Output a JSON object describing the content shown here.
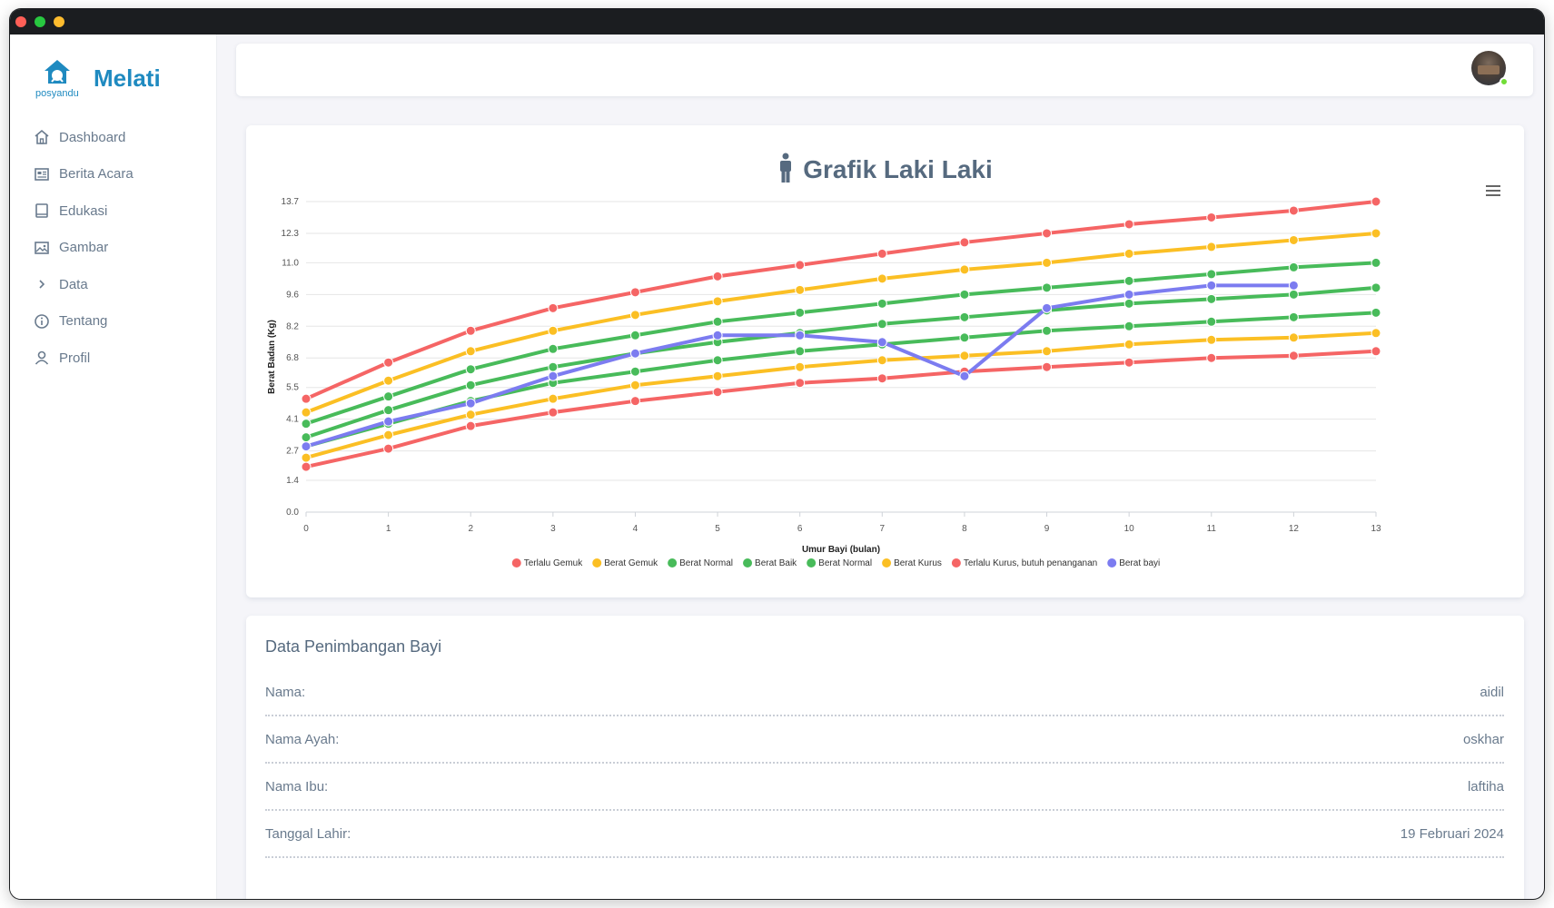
{
  "app": {
    "brand_name": "Melati",
    "logo_caption": "posyandu"
  },
  "sidebar": {
    "items": [
      {
        "label": "Dashboard",
        "icon": "home-icon"
      },
      {
        "label": "Berita Acara",
        "icon": "news-icon"
      },
      {
        "label": "Edukasi",
        "icon": "book-icon"
      },
      {
        "label": "Gambar",
        "icon": "image-icon"
      },
      {
        "label": "Data",
        "icon": "chevron-right-icon"
      },
      {
        "label": "Tentang",
        "icon": "info-icon"
      },
      {
        "label": "Profil",
        "icon": "user-icon"
      }
    ]
  },
  "topbar": {
    "avatar": "user-avatar",
    "status_color": "#71dd37"
  },
  "chart_card": {
    "title": "Grafik Laki Laki",
    "menu_icon": "hamburger-menu-icon"
  },
  "chart_data": {
    "type": "line",
    "title": "Grafik Laki Laki",
    "xlabel": "Umur Bayi (bulan)",
    "ylabel": "Berat Badan (Kg)",
    "x": [
      0,
      1,
      2,
      3,
      4,
      5,
      6,
      7,
      8,
      9,
      10,
      11,
      12,
      13
    ],
    "yticks": [
      "0.0",
      "1.4",
      "2.7",
      "4.1",
      "5.5",
      "6.8",
      "8.2",
      "9.6",
      "11.0",
      "12.3",
      "13.7"
    ],
    "ylim": [
      0,
      13.7
    ],
    "grid": true,
    "legend": "bottom",
    "series": [
      {
        "name": "Terlalu Gemuk",
        "color": "#f56565",
        "values": [
          5.0,
          6.6,
          8.0,
          9.0,
          9.7,
          10.4,
          10.9,
          11.4,
          11.9,
          12.3,
          12.7,
          13.0,
          13.3,
          13.7
        ]
      },
      {
        "name": "Berat Gemuk",
        "color": "#fbbf24",
        "values": [
          4.4,
          5.8,
          7.1,
          8.0,
          8.7,
          9.3,
          9.8,
          10.3,
          10.7,
          11.0,
          11.4,
          11.7,
          12.0,
          12.3
        ]
      },
      {
        "name": "Berat Normal",
        "color": "#48bb5a",
        "values": [
          3.9,
          5.1,
          6.3,
          7.2,
          7.8,
          8.4,
          8.8,
          9.2,
          9.6,
          9.9,
          10.2,
          10.5,
          10.8,
          11.0
        ]
      },
      {
        "name": "Berat Baik",
        "color": "#48bb5a",
        "values": [
          3.3,
          4.5,
          5.6,
          6.4,
          7.0,
          7.5,
          7.9,
          8.3,
          8.6,
          8.9,
          9.2,
          9.4,
          9.6,
          9.9
        ]
      },
      {
        "name": "Berat Normal",
        "color": "#48bb5a",
        "values": [
          2.9,
          3.9,
          4.9,
          5.7,
          6.2,
          6.7,
          7.1,
          7.4,
          7.7,
          8.0,
          8.2,
          8.4,
          8.6,
          8.8
        ]
      },
      {
        "name": "Berat Kurus",
        "color": "#fbbf24",
        "values": [
          2.4,
          3.4,
          4.3,
          5.0,
          5.6,
          6.0,
          6.4,
          6.7,
          6.9,
          7.1,
          7.4,
          7.6,
          7.7,
          7.9
        ]
      },
      {
        "name": "Terlalu Kurus, butuh penanganan",
        "color": "#f56565",
        "values": [
          2.0,
          2.8,
          3.8,
          4.4,
          4.9,
          5.3,
          5.7,
          5.9,
          6.2,
          6.4,
          6.6,
          6.8,
          6.9,
          7.1
        ]
      },
      {
        "name": "Berat bayi",
        "color": "#7c7cf0",
        "values": [
          2.9,
          4.0,
          4.8,
          6.0,
          7.0,
          7.8,
          7.8,
          7.5,
          6.0,
          9.0,
          9.6,
          10.0,
          10.0,
          null
        ]
      }
    ]
  },
  "weighing": {
    "title": "Data Penimbangan Bayi",
    "rows": [
      {
        "label": "Nama:",
        "value": "aidil"
      },
      {
        "label": "Nama Ayah:",
        "value": "oskhar"
      },
      {
        "label": "Nama Ibu:",
        "value": "laftiha"
      },
      {
        "label": "Tanggal Lahir:",
        "value": "19 Februari 2024"
      }
    ]
  }
}
